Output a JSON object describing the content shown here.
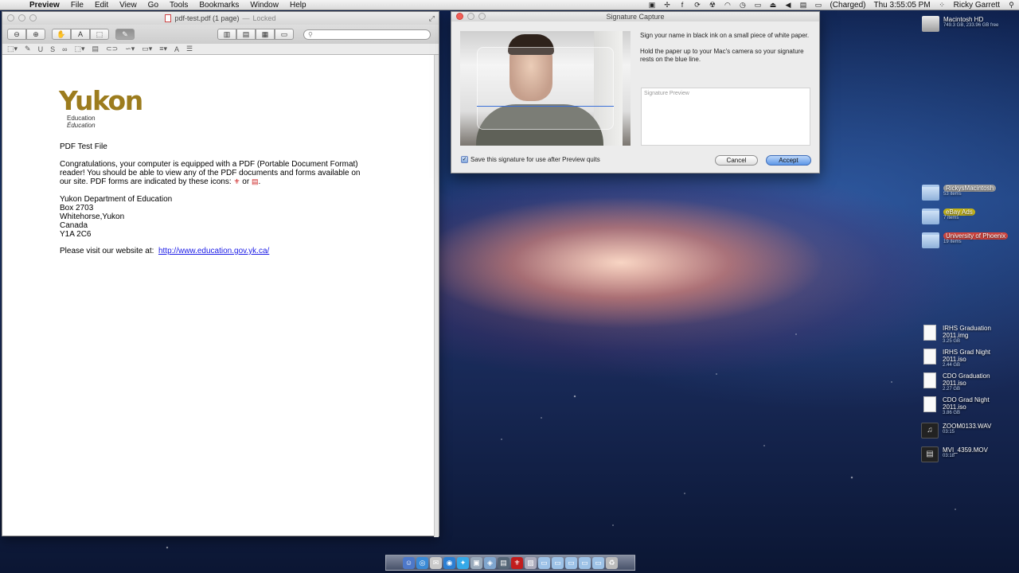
{
  "menubar": {
    "apple_glyph": "",
    "app_name": "Preview",
    "menus": [
      "File",
      "Edit",
      "View",
      "Go",
      "Tools",
      "Bookmarks",
      "Window",
      "Help"
    ],
    "battery_status": "(Charged)",
    "clock": "Thu 3:55:05 PM",
    "user_name": "Ricky Garrett"
  },
  "preview": {
    "title": "pdf-test.pdf (1 page)",
    "title_sep": "—",
    "title_status": "Locked",
    "search": {
      "value": "",
      "placeholder": ""
    },
    "document": {
      "logo_word": "Yukon",
      "logo_line1": "Education",
      "logo_line2": "Éducation",
      "heading": "PDF Test File",
      "para1_line1": "Congratulations, your computer is equipped with a PDF (Portable Document Format)",
      "para1_line2": "reader!  You should be able to view any of the PDF documents and forms available on",
      "para1_line3": "our site.  PDF forms are indicated by these icons:",
      "para1_or": "or",
      "para1_end": ".",
      "addr1": "Yukon Department of Education",
      "addr2": "Box 2703",
      "addr3": "Whitehorse,Yukon",
      "addr4": "Canada",
      "addr5": "Y1A 2C6",
      "visit_text": "Please visit our website at:",
      "visit_link": "http://www.education.gov.yk.ca/"
    }
  },
  "signature": {
    "title": "Signature Capture",
    "instruction1": "Sign your name in black ink on a small piece of white paper.",
    "instruction2": "Hold the paper up to your Mac's camera so your signature rests on the blue line.",
    "preview_label": "Signature Preview",
    "save_label": "Save this signature for use after Preview quits",
    "save_checked": true,
    "cancel_label": "Cancel",
    "accept_label": "Accept"
  },
  "desktop": {
    "items": [
      {
        "name": "Macintosh HD",
        "sub": "749.3 GB, 233.96 GB free",
        "kind": "disk"
      },
      {
        "name": "RickysMacintosh",
        "sub": "53 items",
        "kind": "folder",
        "tag_color": "#9e9e9e"
      },
      {
        "name": "eBay Ads",
        "sub": "7 items",
        "kind": "folder",
        "tag_color": "#c4b41a"
      },
      {
        "name": "University of Phoenix",
        "sub": "19 items",
        "kind": "folder",
        "tag_color": "#d2453f"
      },
      {
        "name": "IRHS Graduation 2011.img",
        "sub": "3.25 GB",
        "kind": "file"
      },
      {
        "name": "IRHS Grad Night 2011.iso",
        "sub": "2.44 GB",
        "kind": "file"
      },
      {
        "name": "CDO Graduation 2011.iso",
        "sub": "2.27 GB",
        "kind": "file"
      },
      {
        "name": "CDO Grad Night 2011.iso",
        "sub": "3.86 GB",
        "kind": "file"
      },
      {
        "name": "ZOOM0133.WAV",
        "sub": "03:15",
        "kind": "audio"
      },
      {
        "name": "MVI_4359.MOV",
        "sub": "03:18",
        "kind": "video"
      }
    ]
  }
}
